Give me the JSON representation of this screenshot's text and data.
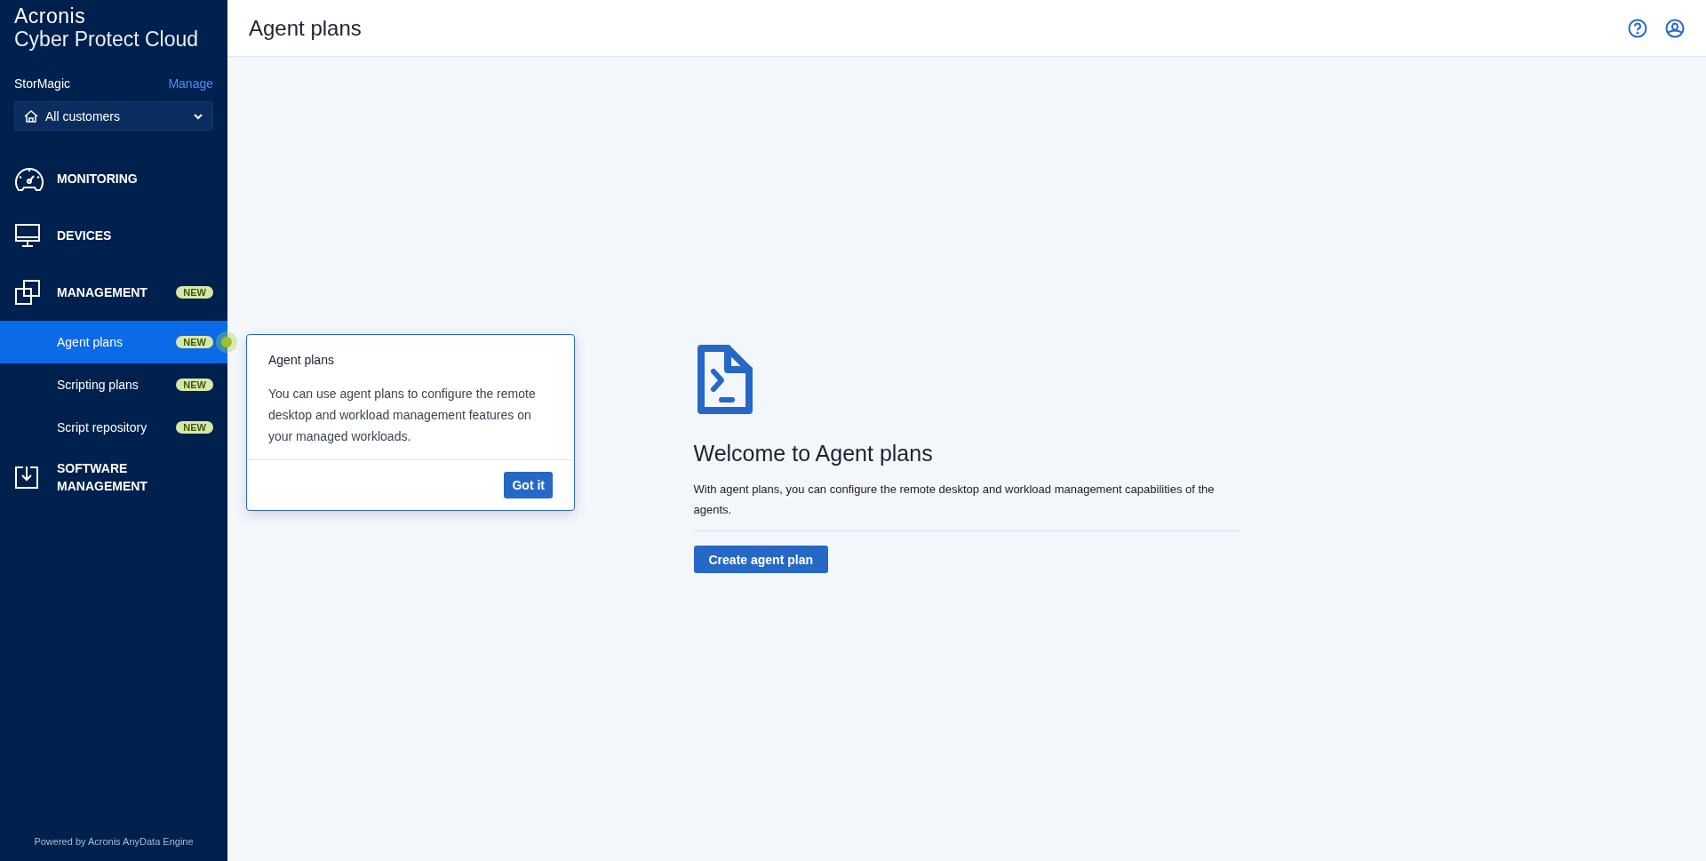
{
  "brand": {
    "name": "Acronis",
    "product": "Cyber Protect Cloud"
  },
  "tenant": {
    "name": "StorMagic",
    "action": "Manage"
  },
  "customer_select": {
    "value": "All customers"
  },
  "nav": [
    {
      "kind": "section",
      "label": "MONITORING",
      "selected": false
    },
    {
      "kind": "section",
      "label": "DEVICES",
      "selected": false
    },
    {
      "kind": "section",
      "label": "MANAGEMENT",
      "badge": "NEW",
      "selected": false
    },
    {
      "kind": "sub",
      "label": "Agent plans",
      "badge": "NEW",
      "selected": true
    },
    {
      "kind": "sub",
      "label": "Scripting plans",
      "badge": "NEW",
      "selected": false
    },
    {
      "kind": "sub",
      "label": "Script repository",
      "badge": "NEW",
      "selected": false
    },
    {
      "kind": "section",
      "label": "SOFTWARE MANAGEMENT",
      "selected": false
    }
  ],
  "footer": "Powered by Acronis AnyData Engine",
  "header": {
    "title": "Agent plans"
  },
  "welcome": {
    "title": "Welcome to Agent plans",
    "text": "With agent plans, you can configure the remote desktop and workload management capabilities of the agents.",
    "button": "Create agent plan"
  },
  "popover": {
    "title": "Agent plans",
    "body": "You can use agent plans to configure the remote desktop and workload management features on your managed workloads.",
    "button": "Got it"
  }
}
